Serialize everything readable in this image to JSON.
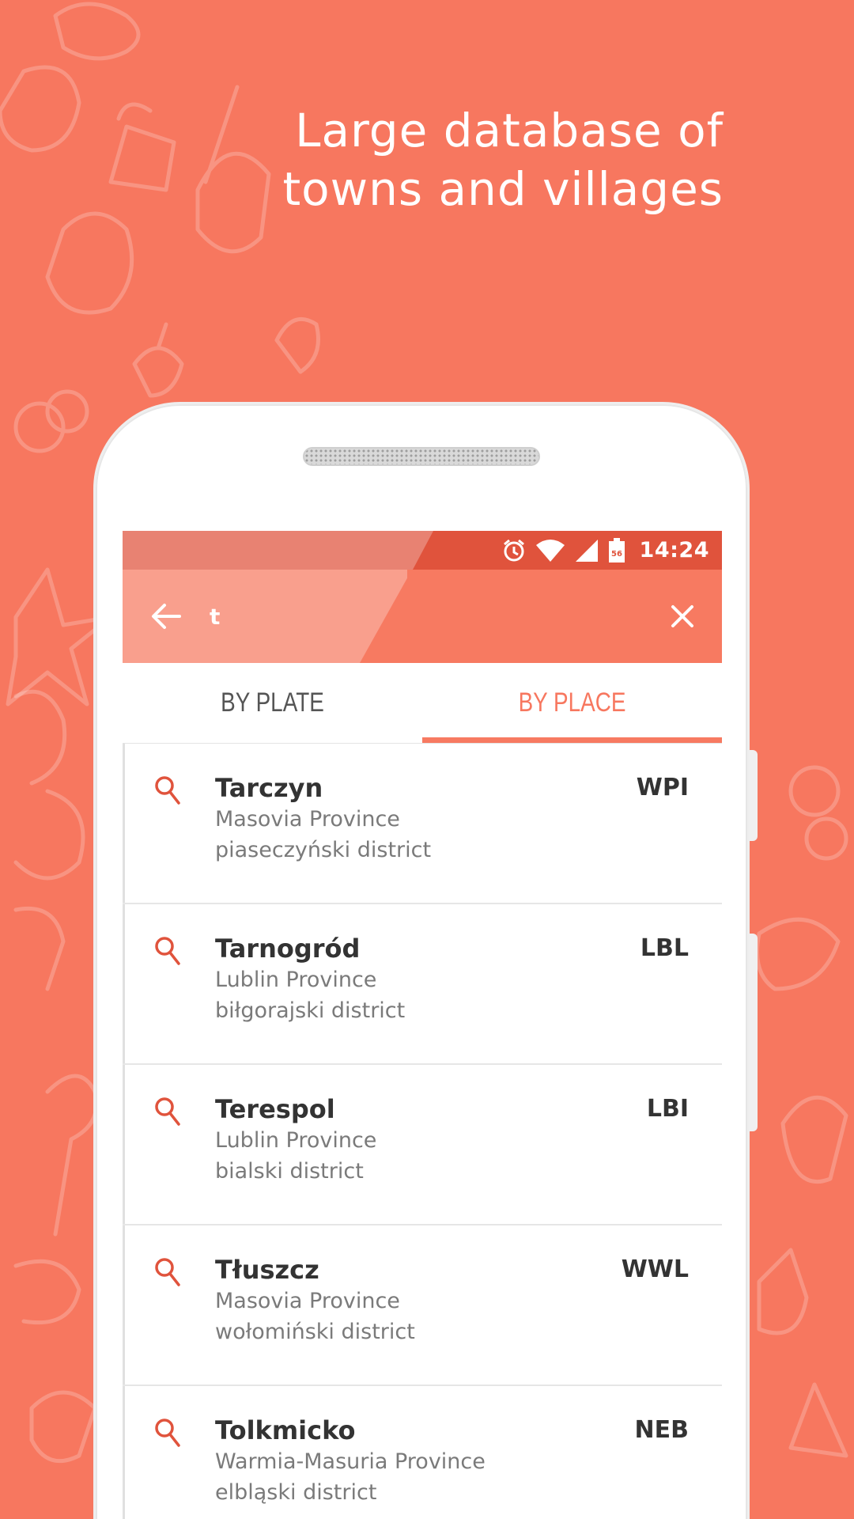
{
  "headline": {
    "line1": "Large database of",
    "line2": "towns and villages"
  },
  "colors": {
    "background": "#F7775F",
    "status_bar": "#E0533C",
    "toolbar": "#F77A61",
    "accent": "#F7775F"
  },
  "status_bar": {
    "time": "14:24",
    "icons": [
      "alarm-icon",
      "wifi-icon",
      "signal-icon",
      "battery-icon"
    ],
    "battery_level": "56"
  },
  "search": {
    "value": "t",
    "back_icon": "arrow-left-icon",
    "clear_icon": "close-icon"
  },
  "tabs": [
    {
      "label": "BY PLATE",
      "active": false
    },
    {
      "label": "BY PLACE",
      "active": true
    }
  ],
  "results": [
    {
      "city": "Tarczyn",
      "province": "Masovia Province",
      "district": "piaseczyński district",
      "plate": "WPI"
    },
    {
      "city": "Tarnogród",
      "province": "Lublin Province",
      "district": "biłgorajski district",
      "plate": "LBL"
    },
    {
      "city": "Terespol",
      "province": "Lublin Province",
      "district": "bialski district",
      "plate": "LBI"
    },
    {
      "city": "Tłuszcz",
      "province": "Masovia Province",
      "district": "wołomiński district",
      "plate": "WWL"
    },
    {
      "city": "Tolkmicko",
      "province": "Warmia-Masuria Province",
      "district": "elbląski district",
      "plate": "NEB"
    }
  ]
}
